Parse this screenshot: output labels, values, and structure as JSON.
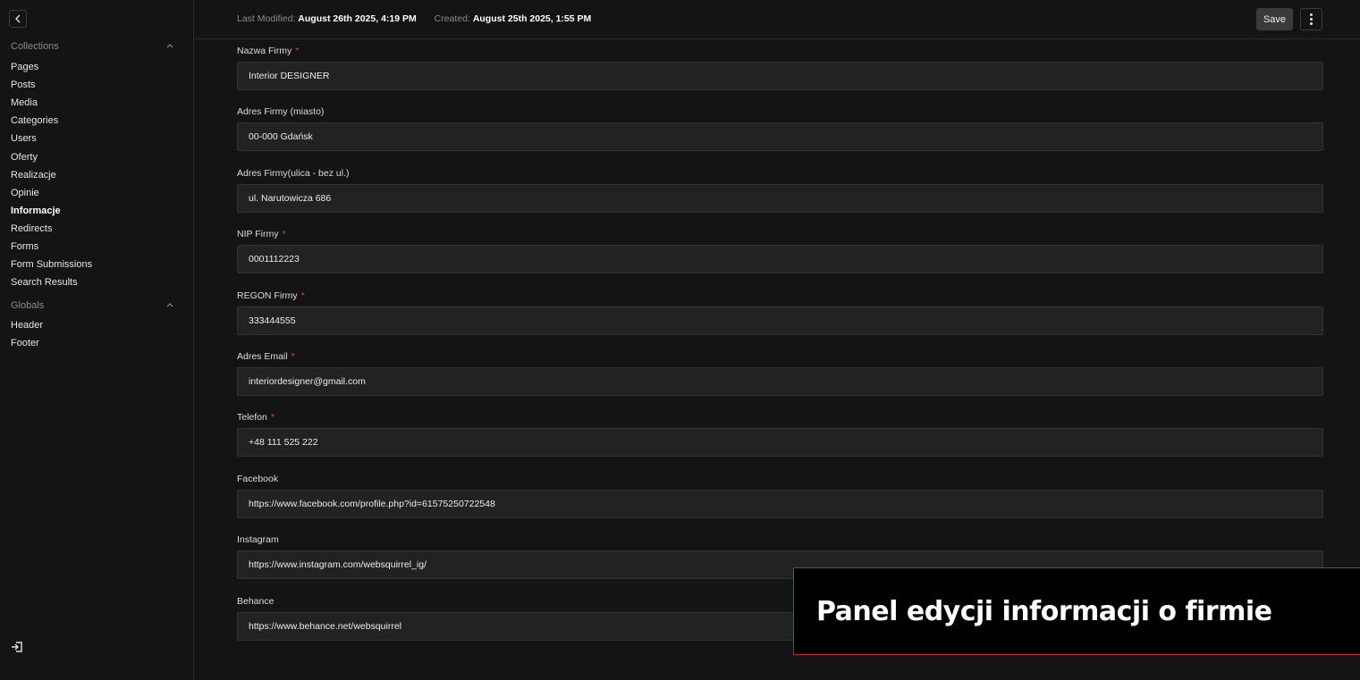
{
  "sidebar": {
    "collections_label": "Collections",
    "globals_label": "Globals",
    "collections": [
      "Pages",
      "Posts",
      "Media",
      "Categories",
      "Users",
      "Oferty",
      "Realizacje",
      "Opinie",
      "Informacje",
      "Redirects",
      "Forms",
      "Form Submissions",
      "Search Results"
    ],
    "globals": [
      "Header",
      "Footer"
    ],
    "active": "Informacje"
  },
  "header": {
    "last_modified_label": "Last Modified:",
    "last_modified_value": "August 26th 2025, 4:19 PM",
    "created_label": "Created:",
    "created_value": "August 25th 2025, 1:55 PM",
    "save_label": "Save"
  },
  "fields": [
    {
      "label": "Nazwa Firmy",
      "required": true,
      "value": "Interior DESIGNER"
    },
    {
      "label": "Adres Firmy (miasto)",
      "required": false,
      "value": "00-000 Gdańsk"
    },
    {
      "label": "Adres Firmy(ulica - bez ul.)",
      "required": false,
      "value": "ul. Narutowicza 686"
    },
    {
      "label": "NIP Firmy",
      "required": true,
      "value": "0001112223"
    },
    {
      "label": "REGON Firmy",
      "required": true,
      "value": "333444555"
    },
    {
      "label": "Adres Email",
      "required": true,
      "value": "interiordesigner@gmail.com"
    },
    {
      "label": "Telefon",
      "required": true,
      "value": "+48 111 525 222"
    },
    {
      "label": "Facebook",
      "required": false,
      "value": "https://www.facebook.com/profile.php?id=61575250722548"
    },
    {
      "label": "Instagram",
      "required": false,
      "value": "https://www.instagram.com/websquirrel_ig/"
    },
    {
      "label": "Behance",
      "required": false,
      "value": "https://www.behance.net/websquirrel"
    }
  ],
  "required_marker": "*",
  "caption": "Panel edycji informacji o firmie",
  "colors": {
    "background": "#141414",
    "input_background": "#222222",
    "required": "#e0403c",
    "caption_border": "#c0262c"
  }
}
